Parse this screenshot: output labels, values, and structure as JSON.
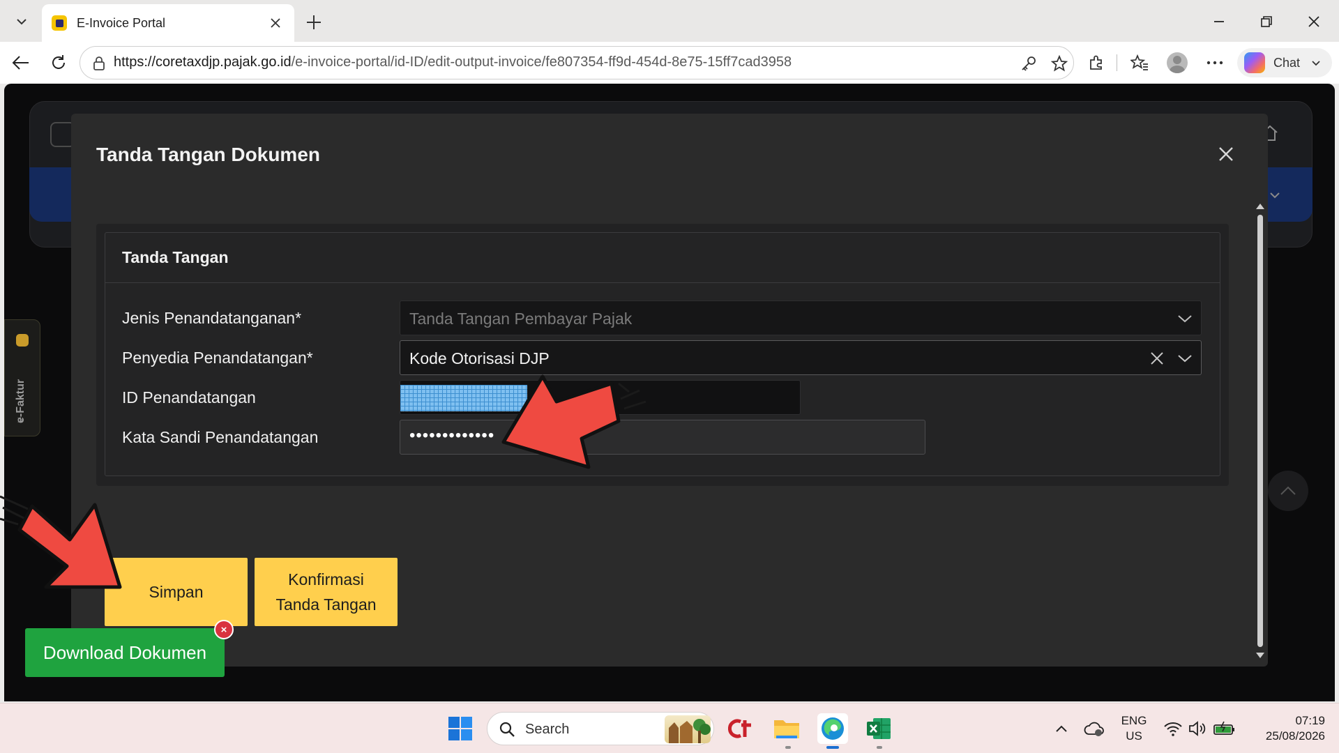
{
  "browser": {
    "tab_title": "E-Invoice Portal",
    "url_host": "https://coretaxdjp.pajak.go.id",
    "url_path": "/e-invoice-portal/id-ID/edit-output-invoice/fe807354-ff9d-454d-8e75-15ff7cad3958",
    "chat_label": "Chat"
  },
  "sidebar": {
    "tab_label": "e-Faktur"
  },
  "modal": {
    "title": "Tanda Tangan Dokumen",
    "section_title": "Tanda Tangan",
    "fields": {
      "jenis": {
        "label": "Jenis Penandatanganan*",
        "value": "Tanda Tangan Pembayar Pajak"
      },
      "penyedia": {
        "label": "Penyedia Penandatangan*",
        "value": "Kode Otorisasi DJP"
      },
      "id": {
        "label": "ID Penandatangan",
        "value": ""
      },
      "password": {
        "label": "Kata Sandi Penandatangan",
        "value": "•••••••••••••"
      }
    },
    "buttons": {
      "save": "Simpan",
      "confirm_line1": "Konfirmasi",
      "confirm_line2": "Tanda Tangan"
    }
  },
  "toast": {
    "label": "Download Dokumen",
    "close": "×"
  },
  "taskbar": {
    "search_label": "Search",
    "lang_line1": "ENG",
    "lang_line2": "US",
    "time": "07:19",
    "date": "25/08/2026"
  },
  "colors": {
    "accent_yellow": "#ffcf4d",
    "toast_green": "#1fa33f",
    "annotation_red": "#ef4a41"
  },
  "icons": [
    "tab-search-icon",
    "close-icon",
    "plus-icon",
    "minimize-icon",
    "restore-icon",
    "back-icon",
    "refresh-icon",
    "lock-icon",
    "key-icon",
    "star-icon",
    "extensions-icon",
    "favorites-icon",
    "more-icon",
    "copilot-icon",
    "chevron-down-icon",
    "home-icon",
    "windows-start-icon",
    "search-icon",
    "file-explorer-icon",
    "edge-icon",
    "excel-icon",
    "wifi-icon",
    "volume-icon",
    "battery-icon"
  ]
}
